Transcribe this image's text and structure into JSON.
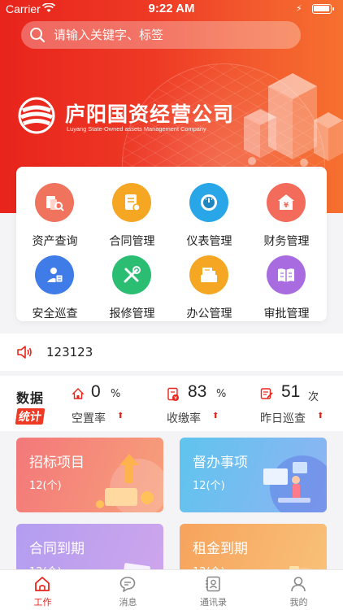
{
  "status_bar": {
    "carrier": "Carrier",
    "time": "9:22 AM"
  },
  "search": {
    "placeholder": "请输入关键字、标签",
    "icon": "search-icon"
  },
  "brand": {
    "name": "庐阳国资经营公司",
    "name_en": "Luyang State-Owned assets Management Company"
  },
  "colors": {
    "primary": "#e8241c",
    "orange": "#f6702f"
  },
  "modules": [
    {
      "label": "资产查询",
      "icon": "asset-search-icon",
      "color": "#f0735e"
    },
    {
      "label": "合同管理",
      "icon": "contract-icon",
      "color": "#f5a623"
    },
    {
      "label": "仪表管理",
      "icon": "meter-icon",
      "color": "#29a6e8"
    },
    {
      "label": "财务管理",
      "icon": "finance-icon",
      "color": "#f26b5b"
    },
    {
      "label": "安全巡查",
      "icon": "patrol-icon",
      "color": "#3f7ce8"
    },
    {
      "label": "报修管理",
      "icon": "repair-icon",
      "color": "#2bbd72"
    },
    {
      "label": "办公管理",
      "icon": "office-icon",
      "color": "#f5a623"
    },
    {
      "label": "审批管理",
      "icon": "approval-icon",
      "color": "#a86ce0"
    }
  ],
  "notice": {
    "text": "123123",
    "icon": "speaker-icon"
  },
  "stats": {
    "title_line1": "数据",
    "title_line2": "统计",
    "items": [
      {
        "value": "0",
        "unit": "%",
        "label": "空置率",
        "icon": "house-icon"
      },
      {
        "value": "83",
        "unit": "%",
        "label": "收缴率",
        "icon": "receipt-icon"
      },
      {
        "value": "51",
        "unit": "次",
        "label": "昨日巡查",
        "icon": "inspection-icon"
      }
    ]
  },
  "cards": [
    {
      "title": "招标项目",
      "count": "12(个)"
    },
    {
      "title": "督办事项",
      "count": "12(个)"
    },
    {
      "title": "合同到期",
      "count": "12(个)"
    },
    {
      "title": "租金到期",
      "count": "12(个)"
    }
  ],
  "tabs": [
    {
      "label": "工作",
      "icon": "home-icon",
      "active": true
    },
    {
      "label": "消息",
      "icon": "message-icon",
      "active": false
    },
    {
      "label": "通讯录",
      "icon": "contacts-icon",
      "active": false
    },
    {
      "label": "我的",
      "icon": "profile-icon",
      "active": false
    }
  ]
}
